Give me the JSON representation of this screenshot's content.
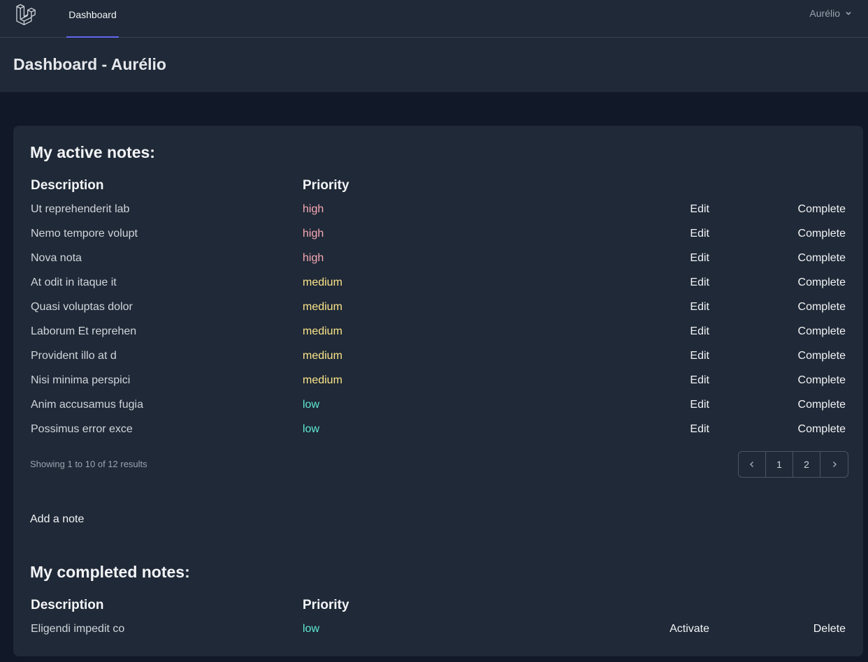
{
  "nav": {
    "dashboard_label": "Dashboard",
    "user_name": "Aurélio",
    "logo_icon": "laravel-logo-icon",
    "chevron_icon": "chevron-down-icon"
  },
  "header": {
    "title": "Dashboard - Aurélio"
  },
  "active": {
    "title": "My active notes:",
    "col_description": "Description",
    "col_priority": "Priority",
    "rows": [
      {
        "description": "Ut reprehenderit lab",
        "priority": "high",
        "edit": "Edit",
        "complete": "Complete"
      },
      {
        "description": "Nemo tempore volupt",
        "priority": "high",
        "edit": "Edit",
        "complete": "Complete"
      },
      {
        "description": "Nova nota",
        "priority": "high",
        "edit": "Edit",
        "complete": "Complete"
      },
      {
        "description": "At odit in itaque it",
        "priority": "medium",
        "edit": "Edit",
        "complete": "Complete"
      },
      {
        "description": "Quasi voluptas dolor",
        "priority": "medium",
        "edit": "Edit",
        "complete": "Complete"
      },
      {
        "description": "Laborum Et reprehen",
        "priority": "medium",
        "edit": "Edit",
        "complete": "Complete"
      },
      {
        "description": "Provident illo at d",
        "priority": "medium",
        "edit": "Edit",
        "complete": "Complete"
      },
      {
        "description": "Nisi minima perspici",
        "priority": "medium",
        "edit": "Edit",
        "complete": "Complete"
      },
      {
        "description": "Anim accusamus fugia",
        "priority": "low",
        "edit": "Edit",
        "complete": "Complete"
      },
      {
        "description": "Possimus error exce",
        "priority": "low",
        "edit": "Edit",
        "complete": "Complete"
      }
    ],
    "showing": "Showing 1 to 10 of 12 results",
    "pagination": {
      "prev_icon": "chevron-left-icon",
      "pages": [
        "1",
        "2"
      ],
      "next_icon": "chevron-right-icon"
    },
    "add_note": "Add a note"
  },
  "completed": {
    "title": "My completed notes:",
    "col_description": "Description",
    "col_priority": "Priority",
    "rows": [
      {
        "description": "Eligendi impedit co",
        "priority": "low",
        "activate": "Activate",
        "delete": "Delete"
      }
    ]
  },
  "colors": {
    "high": "#f9a8b4",
    "medium": "#fde68a",
    "low": "#5eead4",
    "accent": "#6366f1"
  }
}
